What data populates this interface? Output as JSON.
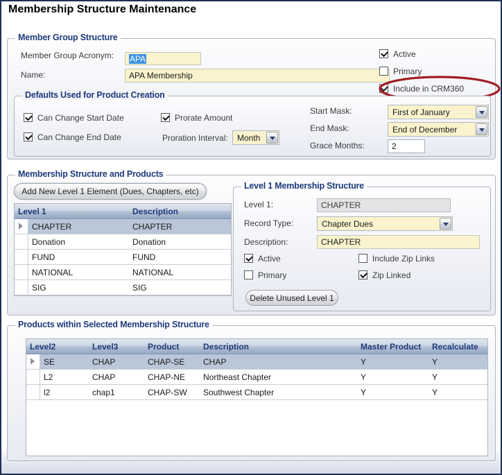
{
  "page_title": "Membership Structure Maintenance",
  "member_group": {
    "title": "Member Group Structure",
    "acronym_label": "Member Group Acronym:",
    "acronym_value": "APA",
    "name_label": "Name:",
    "name_value": "APA Membership",
    "cb_active": {
      "label": "Active",
      "checked": true
    },
    "cb_primary": {
      "label": "Primary",
      "checked": false
    },
    "cb_crm360": {
      "label": "Include in CRM360",
      "checked": true
    }
  },
  "defaults": {
    "title": "Defaults Used for Product Creation",
    "cb_start": {
      "label": "Can Change Start Date",
      "checked": true
    },
    "cb_end": {
      "label": "Can Change End Date",
      "checked": true
    },
    "cb_prorate": {
      "label": "Prorate Amount",
      "checked": true
    },
    "proration_label": "Proration Interval:",
    "proration_value": "Month",
    "start_mask_label": "Start Mask:",
    "start_mask_value": "First of January",
    "end_mask_label": "End Mask:",
    "end_mask_value": "End of December",
    "grace_label": "Grace Months:",
    "grace_value": "2"
  },
  "structure_section": {
    "title": "Membership Structure and Products",
    "add_button_label": "Add New Level 1 Element (Dues, Chapters, etc)",
    "level1_grid": {
      "columns": [
        "Level 1",
        "Description"
      ],
      "rows": [
        [
          "CHAPTER",
          "CHAPTER"
        ],
        [
          "Donation",
          "Donation"
        ],
        [
          "FUND",
          "FUND"
        ],
        [
          "NATIONAL",
          "NATIONAL"
        ],
        [
          "SIG",
          "SIG"
        ]
      ],
      "selected_row": 0
    },
    "level1_detail": {
      "title": "Level 1 Membership Structure",
      "level1_label": "Level 1:",
      "level1_value": "CHAPTER",
      "record_type_label": "Record Type:",
      "record_type_value": "Chapter Dues",
      "description_label": "Description:",
      "description_value": "CHAPTER",
      "cb_active": {
        "label": "Active",
        "checked": true
      },
      "cb_primary": {
        "label": "Primary",
        "checked": false
      },
      "cb_zip_links": {
        "label": "Include Zip Links",
        "checked": false
      },
      "cb_zip_linked": {
        "label": "Zip Linked",
        "checked": true
      },
      "delete_button_label": "Delete Unused Level 1"
    }
  },
  "products_section": {
    "title": "Products within Selected Membership Structure",
    "grid": {
      "columns": [
        "Level2",
        "Level3",
        "Product",
        "Description",
        "Master Product",
        "Recalculate"
      ],
      "rows": [
        [
          "SE",
          "CHAP",
          "CHAP-SE",
          "CHAP",
          "Y",
          "Y"
        ],
        [
          "L2",
          "CHAP",
          "CHAP-NE",
          "Northeast Chapter",
          "Y",
          "Y"
        ],
        [
          "l2",
          "chap1",
          "CHAP-SW",
          "Southwest Chapter",
          "Y",
          "Y"
        ]
      ],
      "selected_row": 0
    }
  },
  "colors": {
    "annotation_red": "#a21d23",
    "field_yellow": "#faf3cd",
    "selection_blue": "#3c92e5",
    "grid_selected": "#b9c7d9",
    "group_title_navy": "#1e3a7c"
  }
}
